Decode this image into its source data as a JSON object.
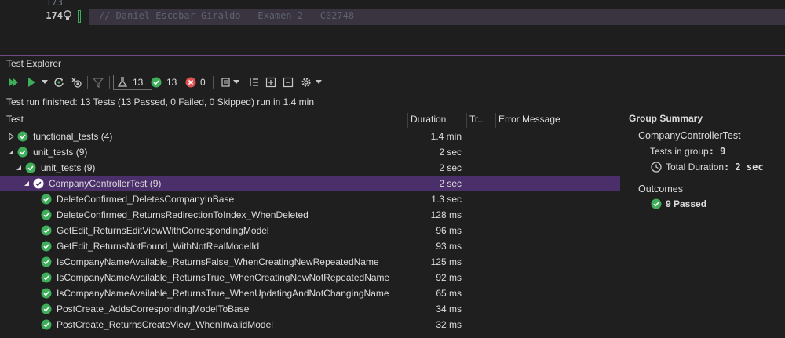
{
  "editor": {
    "line_numbers": [
      "173",
      "174"
    ],
    "code_line": "// Daniel Escobar Giraldo - Examen 2 - C02748"
  },
  "panel": {
    "title": "Test Explorer"
  },
  "toolbar": {
    "total_count": "13",
    "passed_count": "13",
    "failed_count": "0"
  },
  "summary": "Test run finished: 13 Tests (13 Passed, 0 Failed, 0 Skipped) run in 1.4 min",
  "columns": [
    "Test",
    "Duration",
    "Tr...",
    "Error Message"
  ],
  "rows": [
    {
      "name": "functional_tests  (4)",
      "duration": "1.4 min"
    },
    {
      "name": "unit_tests  (9)",
      "duration": "2 sec"
    },
    {
      "name": "unit_tests  (9)",
      "duration": "2 sec"
    },
    {
      "name": "CompanyControllerTest  (9)",
      "duration": "2 sec"
    },
    {
      "name": "DeleteConfirmed_DeletesCompanyInBase",
      "duration": "1.3 sec"
    },
    {
      "name": "DeleteConfirmed_ReturnsRedirectionToIndex_WhenDeleted",
      "duration": "128 ms"
    },
    {
      "name": "GetEdit_ReturnsEditViewWithCorrespondingModel",
      "duration": "96 ms"
    },
    {
      "name": "GetEdit_ReturnsNotFound_WithNotRealModelId",
      "duration": "93 ms"
    },
    {
      "name": "IsCompanyNameAvailable_ReturnsFalse_WhenCreatingNewRepeatedName",
      "duration": "125 ms"
    },
    {
      "name": "IsCompanyNameAvailable_ReturnsTrue_WhenCreatingNewNotRepeatedName",
      "duration": "92 ms"
    },
    {
      "name": "IsCompanyNameAvailable_ReturnsTrue_WhenUpdatingAndNotChangingName",
      "duration": "65 ms"
    },
    {
      "name": "PostCreate_AddsCorrespondingModelToBase",
      "duration": "34 ms"
    },
    {
      "name": "PostCreate_ReturnsCreateView_WhenInvalidModel",
      "duration": "32 ms"
    }
  ],
  "group_summary": {
    "heading": "Group Summary",
    "group_name": "CompanyControllerTest",
    "tests_in_group_label": "Tests in group",
    "tests_in_group_value": "9",
    "total_duration_label": "Total Duration",
    "total_duration_value": "2 sec",
    "outcomes_label": "Outcomes",
    "passed_label": "9 Passed"
  },
  "colors": {
    "accent_purple": "#6e4a86",
    "selected_row": "#4b2f6b",
    "passed_green": "#3fae5a",
    "failed_red": "#e05252"
  }
}
